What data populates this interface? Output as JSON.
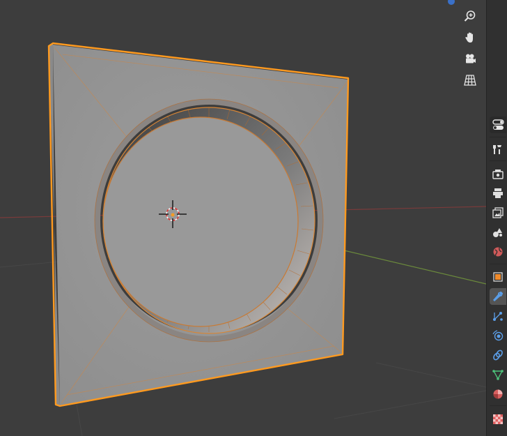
{
  "app": {
    "name": ""
  },
  "colors": {
    "background": "#3d3d3d",
    "panel": "#303030",
    "active_tab": "#545454",
    "selection_outline": "#ff9a1f",
    "mesh_face": "#969696",
    "x_axis": "#8a3a3a",
    "y_axis": "#6a8a3a"
  },
  "navigation_gizmo": [
    {
      "name": "zoom",
      "icon": "zoom-icon"
    },
    {
      "name": "pan",
      "icon": "hand-icon"
    },
    {
      "name": "camera",
      "icon": "camera-icon"
    },
    {
      "name": "ortho",
      "icon": "grid-icon"
    }
  ],
  "properties_tabs": [
    {
      "name": "tool",
      "icon": "wrench-screwdriver-icon"
    },
    {
      "name": "render",
      "icon": "render-icon"
    },
    {
      "name": "output",
      "icon": "printer-icon"
    },
    {
      "name": "view-layer",
      "icon": "view-layer-icon"
    },
    {
      "name": "scene",
      "icon": "scene-icon"
    },
    {
      "name": "world",
      "icon": "world-icon"
    },
    {
      "name": "object",
      "icon": "object-icon"
    },
    {
      "name": "modifiers",
      "icon": "wrench-icon",
      "active": true
    },
    {
      "name": "particles",
      "icon": "particles-icon"
    },
    {
      "name": "physics",
      "icon": "physics-icon"
    },
    {
      "name": "constraints",
      "icon": "constraints-icon"
    },
    {
      "name": "data",
      "icon": "mesh-data-icon"
    },
    {
      "name": "material",
      "icon": "material-icon"
    },
    {
      "name": "texture",
      "icon": "texture-icon"
    }
  ]
}
